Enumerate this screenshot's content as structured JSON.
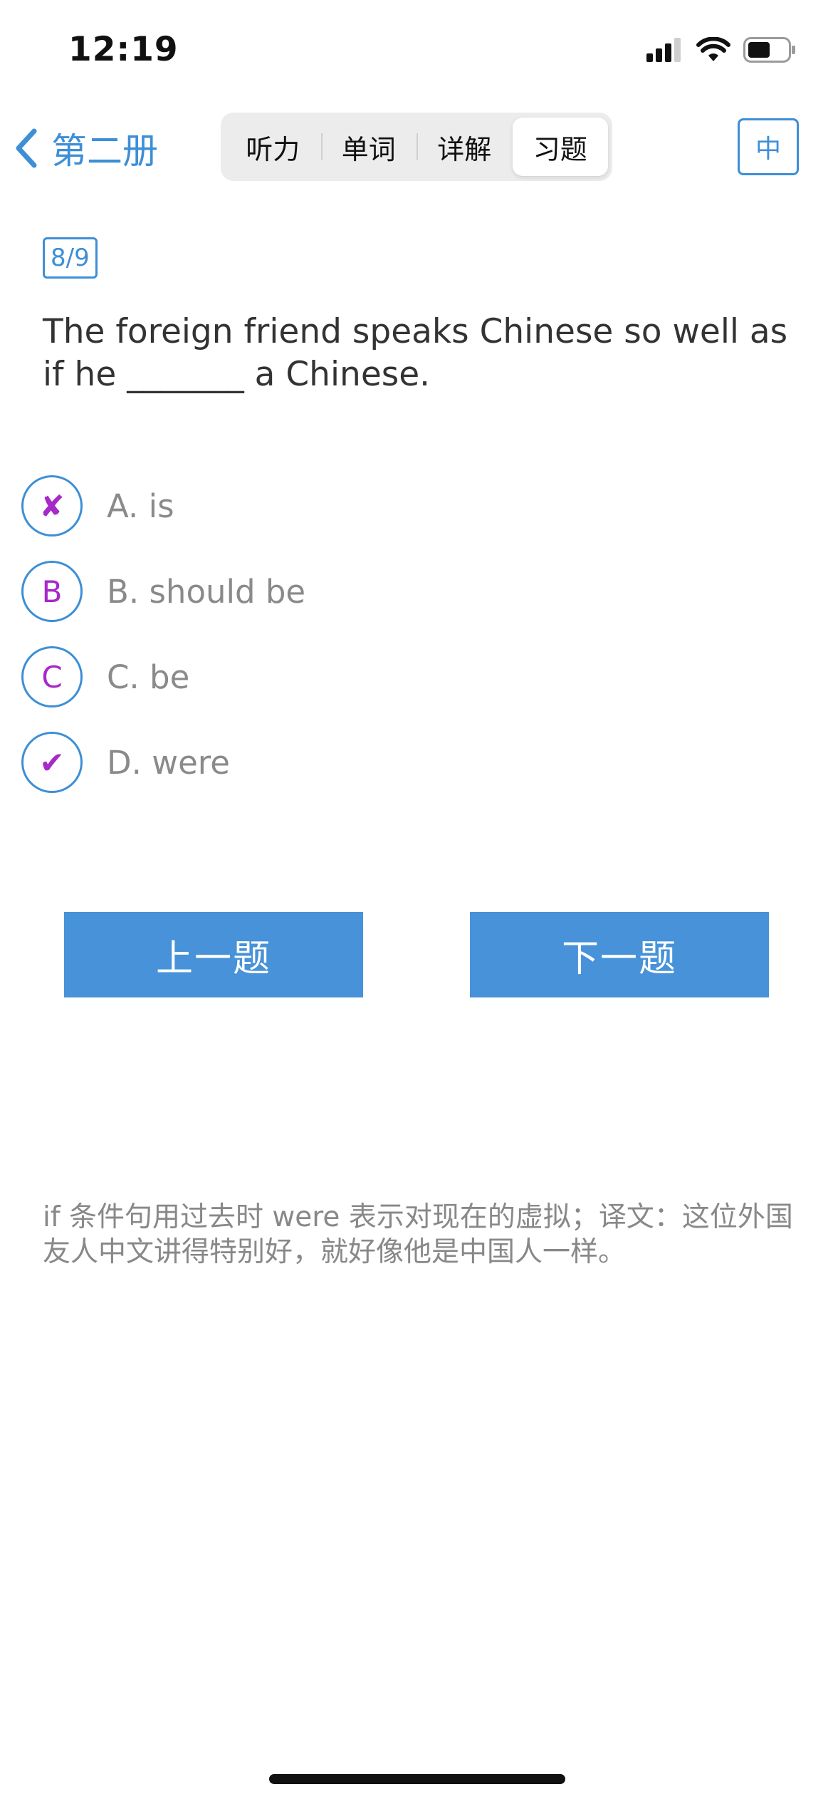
{
  "status_bar": {
    "time": "12:19",
    "icons": [
      "cellular-signal-icon",
      "wifi-icon",
      "battery-icon"
    ]
  },
  "nav": {
    "back_label": "第二册",
    "tabs": [
      {
        "label": "听力",
        "active": false
      },
      {
        "label": "单词",
        "active": false
      },
      {
        "label": "详解",
        "active": false
      },
      {
        "label": "习题",
        "active": true
      }
    ],
    "language_button": "中"
  },
  "question": {
    "progress": "8/9",
    "text": "The foreign friend speaks Chinese so well as if he _______ a Chinese.",
    "options": [
      {
        "marker": "✘",
        "label": "A. is",
        "state": "wrong"
      },
      {
        "marker": "B",
        "label": "B. should be",
        "state": "unselected"
      },
      {
        "marker": "C",
        "label": "C. be",
        "state": "unselected"
      },
      {
        "marker": "✔",
        "label": "D. were",
        "state": "correct"
      }
    ]
  },
  "buttons": {
    "prev": "上一题",
    "next": "下一题"
  },
  "explanation": "if 条件句用过去时 were 表示对现在的虚拟；译文：这位外国友人中文讲得特别好，就好像他是中国人一样。",
  "colors": {
    "accent": "#3d8fd6",
    "button": "#4792d8",
    "marker": "#a629c9",
    "muted_text": "#8a8a8a"
  }
}
